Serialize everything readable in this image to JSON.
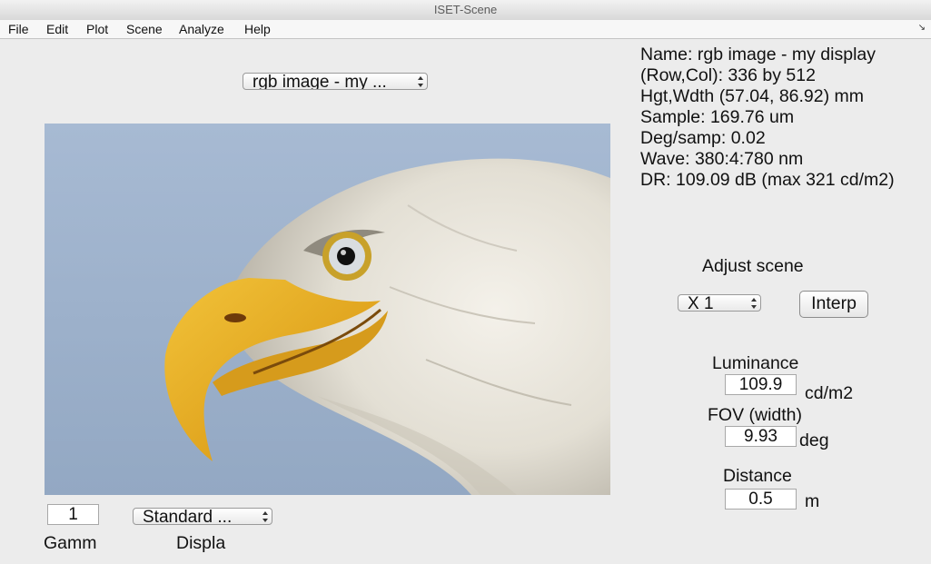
{
  "window": {
    "title": "ISET-Scene"
  },
  "menu": [
    "File",
    "Edit",
    "Plot",
    "Scene",
    "Analyze",
    "Help"
  ],
  "menu_corner_icon": "resize-arrow-icon",
  "scene_select": {
    "value": "rgb image - my ..."
  },
  "info": {
    "name": "Name: rgb image - my display",
    "rowcol": "(Row,Col): 336 by 512",
    "hgtwdth": "Hgt,Wdth (57.04, 86.92) mm",
    "sample": "Sample: 169.76 um",
    "degsamp": "Deg/samp: 0.02",
    "wave": "Wave: 380:4:780 nm",
    "dr": "DR: 109.09 dB (max 321 cd/m2)"
  },
  "adjust": {
    "title": "Adjust scene",
    "resample_value": "X 1",
    "interp_label": "Interp"
  },
  "luminance": {
    "label": "Luminance",
    "value": "109.9",
    "unit": "cd/m2"
  },
  "fov": {
    "label": "FOV (width)",
    "value": "9.93",
    "unit": "deg"
  },
  "distance": {
    "label": "Distance",
    "value": "0.5",
    "unit": "m"
  },
  "gamma": {
    "value": "1",
    "label": "Gamm"
  },
  "display": {
    "value": "Standard ...",
    "label": "Displa"
  },
  "image": {
    "subject": "bald-eagle-head",
    "background_color": "#9db1cb"
  }
}
